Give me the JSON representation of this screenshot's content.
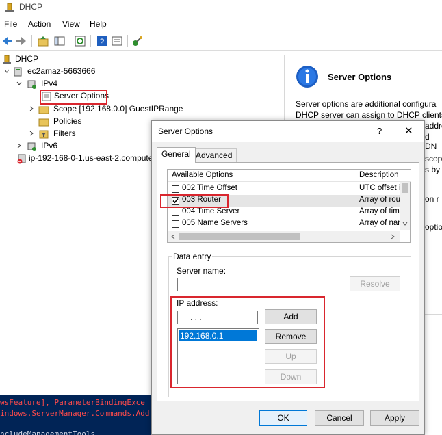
{
  "window": {
    "title": "DHCP"
  },
  "menu": {
    "items": [
      "File",
      "Action",
      "View",
      "Help"
    ]
  },
  "tree": {
    "root": "DHCP",
    "server": "ec2amaz-5663666",
    "ipv4": "IPv4",
    "server_options": "Server Options",
    "scope": "Scope [192.168.0.0] GuestIPRange",
    "policies": "Policies",
    "filters": "Filters",
    "ipv6": "IPv6",
    "other_server": "ip-192-168-0-1.us-east-2.compute"
  },
  "right_pane": {
    "heading": "Server Options",
    "desc_line1": "Server options are additional configura",
    "desc_line2": "DHCP server can assign to DHCP clients.",
    "frag1": "addre",
    "frag2": "d DN",
    "frag3": "scop",
    "frag4": "s by",
    "frag5": "on r",
    "frag6": "optio"
  },
  "console": {
    "line1": "wsFeature], ParameterBindingExce",
    "line2": "indows.ServerManager.Commands.Add",
    "line3": "ncludeManagementTools"
  },
  "dialog": {
    "title": "Server Options",
    "help": "?",
    "close": "✕",
    "tabs": [
      "General",
      "Advanced"
    ],
    "columns": {
      "available": "Available Options",
      "description": "Description"
    },
    "options": [
      {
        "name": "002 Time Offset",
        "desc": "UTC offset i",
        "checked": false
      },
      {
        "name": "003 Router",
        "desc": "Array of rout",
        "checked": true
      },
      {
        "name": "004 Time Server",
        "desc": "Array of time",
        "checked": false
      },
      {
        "name": "005 Name Servers",
        "desc": "Array of nam",
        "checked": false
      }
    ],
    "data_entry": {
      "group_label": "Data entry",
      "server_name_label": "Server name:",
      "server_name_value": "",
      "resolve_label": "Resolve",
      "ip_label": "IP address:",
      "ip_placeholder": ".   .   .",
      "add_label": "Add",
      "remove_label": "Remove",
      "up_label": "Up",
      "down_label": "Down",
      "ip_list": [
        "192.168.0.1"
      ]
    },
    "buttons": {
      "ok": "OK",
      "cancel": "Cancel",
      "apply": "Apply"
    }
  },
  "colors": {
    "highlight": "#d9262e",
    "selection": "#0078d7",
    "console_bg": "#012456",
    "console_err": "#ff4b4b"
  }
}
